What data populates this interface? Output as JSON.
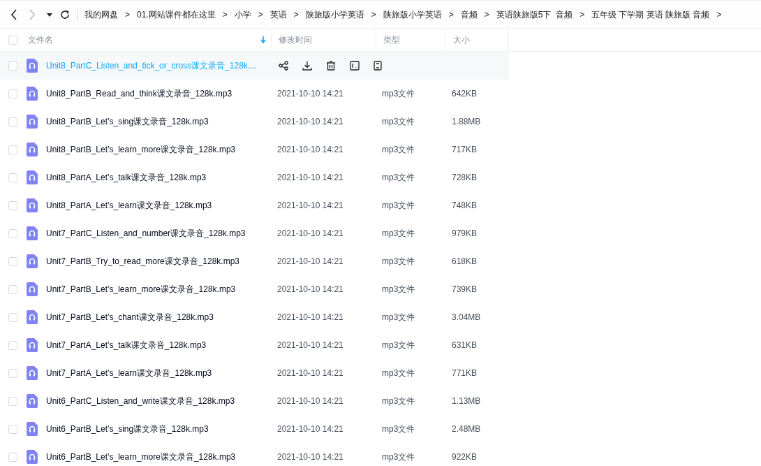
{
  "nav": {
    "back_disabled": false,
    "forward_disabled": true
  },
  "breadcrumb": [
    {
      "label": "我的网盘",
      "separator": ">"
    },
    {
      "label": "01.网站课件都在这里",
      "separator": ">"
    },
    {
      "label": "小学",
      "separator": ">"
    },
    {
      "label": "英语",
      "separator": ">"
    },
    {
      "label": "陕旅版小学英语",
      "separator": ">"
    },
    {
      "label": "陕旅版小学英语",
      "separator": ">"
    },
    {
      "label": "音频",
      "separator": ">"
    },
    {
      "label": "英语陕旅版5下  音频",
      "separator": ">"
    },
    {
      "label": "五年级 下学期 英语 陕旅版 音频",
      "separator": ">"
    }
  ],
  "table": {
    "select_all_checked": false,
    "columns": [
      {
        "label": "文件名",
        "sorted": true
      },
      {
        "label": "修改时间",
        "sorted": false
      },
      {
        "label": "类型",
        "sorted": false
      },
      {
        "label": "大小",
        "sorted": false
      }
    ],
    "rows": [
      {
        "name": "Unit8_PartC_Listen_and_tick_or_cross课文录音_128k....",
        "selected": true,
        "checked": false
      },
      {
        "name": "Unit8_PartB_Read_and_think课文录音_128k.mp3",
        "modified": "2021-10-10 14:21",
        "type": "mp3文件",
        "size": "642KB",
        "selected": false,
        "checked": false
      },
      {
        "name": "Unit8_PartB_Let’s_sing课文录音_128k.mp3",
        "modified": "2021-10-10 14:21",
        "type": "mp3文件",
        "size": "1.88MB",
        "selected": false,
        "checked": false
      },
      {
        "name": "Unit8_PartB_Let’s_learn_more课文录音_128k.mp3",
        "modified": "2021-10-10 14:21",
        "type": "mp3文件",
        "size": "717KB",
        "selected": false,
        "checked": false
      },
      {
        "name": "Unit8_PartA_Let’s_talk课文录音_128k.mp3",
        "modified": "2021-10-10 14:21",
        "type": "mp3文件",
        "size": "728KB",
        "selected": false,
        "checked": false
      },
      {
        "name": "Unit8_PartA_Let’s_learn课文录音_128k.mp3",
        "modified": "2021-10-10 14:21",
        "type": "mp3文件",
        "size": "748KB",
        "selected": false,
        "checked": false
      },
      {
        "name": "Unit7_PartC_Listen_and_number课文录音_128k.mp3",
        "modified": "2021-10-10 14:21",
        "type": "mp3文件",
        "size": "979KB",
        "selected": false,
        "checked": false
      },
      {
        "name": "Unit7_PartB_Try_to_read_more课文录音_128k.mp3",
        "modified": "2021-10-10 14:21",
        "type": "mp3文件",
        "size": "618KB",
        "selected": false,
        "checked": false
      },
      {
        "name": "Unit7_PartB_Let’s_learn_more课文录音_128k.mp3",
        "modified": "2021-10-10 14:21",
        "type": "mp3文件",
        "size": "739KB",
        "selected": false,
        "checked": false
      },
      {
        "name": "Unit7_PartB_Let’s_chant课文录音_128k.mp3",
        "modified": "2021-10-10 14:21",
        "type": "mp3文件",
        "size": "3.04MB",
        "selected": false,
        "checked": false
      },
      {
        "name": "Unit7_PartA_Let’s_talk课文录音_128k.mp3",
        "modified": "2021-10-10 14:21",
        "type": "mp3文件",
        "size": "631KB",
        "selected": false,
        "checked": false
      },
      {
        "name": "Unit7_PartA_Let’s_learn课文录音_128k.mp3",
        "modified": "2021-10-10 14:21",
        "type": "mp3文件",
        "size": "771KB",
        "selected": false,
        "checked": false
      },
      {
        "name": "Unit6_PartC_Listen_and_write课文录音_128k.mp3",
        "modified": "2021-10-10 14:21",
        "type": "mp3文件",
        "size": "1.13MB",
        "selected": false,
        "checked": false
      },
      {
        "name": "Unit6_PartB_Let’s_sing课文录音_128k.mp3",
        "modified": "2021-10-10 14:21",
        "type": "mp3文件",
        "size": "2.48MB",
        "selected": false,
        "checked": false
      },
      {
        "name": "Unit6_PartB_Let’s_learn_more课文录音_128k.mp3",
        "modified": "2021-10-10 14:21",
        "type": "mp3文件",
        "size": "922KB",
        "selected": false,
        "checked": false
      }
    ]
  }
}
